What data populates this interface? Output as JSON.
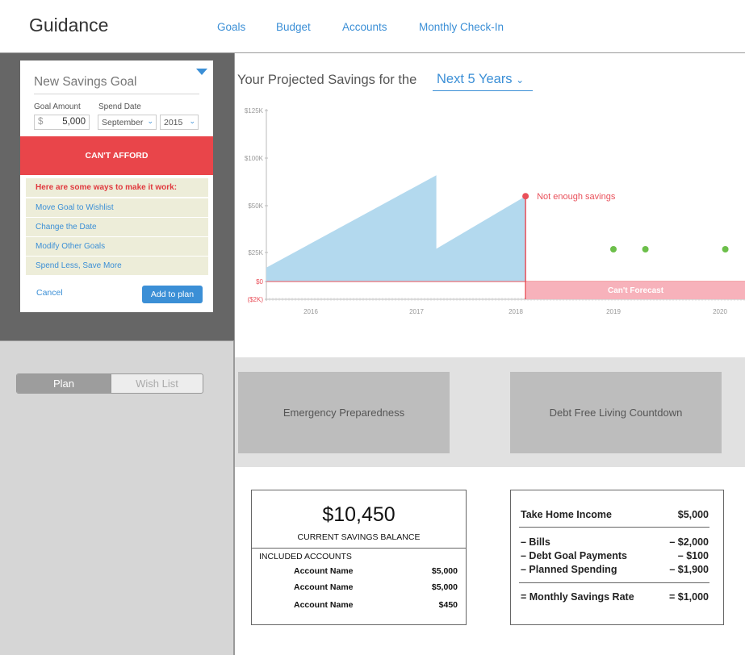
{
  "app": {
    "title": "Guidance"
  },
  "nav": {
    "goals": "Goals",
    "budget": "Budget",
    "accounts": "Accounts",
    "checkin": "Monthly Check-In"
  },
  "goal_form": {
    "name_placeholder": "New Savings Goal",
    "amount_label": "Goal Amount",
    "spend_date_label": "Spend Date",
    "currency": "$",
    "amount": "5,000",
    "month": "September",
    "year": "2015",
    "status": "CAN'T AFFORD",
    "ways_title": "Here are some ways to make it work:",
    "options": [
      "Move Goal to Wishlist",
      "Change the Date",
      "Modify Other Goals",
      "Spend Less, Save More"
    ],
    "cancel": "Cancel",
    "add": "Add to plan"
  },
  "toggle": {
    "plan": "Plan",
    "wishlist": "Wish List"
  },
  "projection": {
    "title": "Your Projected Savings for the",
    "period": "Next 5 Years"
  },
  "chart_data": {
    "type": "area",
    "title": "Your Projected Savings for the Next 5 Years",
    "y_ticks": [
      "$125K",
      "$100K",
      "$50K",
      "$25K",
      "$0",
      "($2K)"
    ],
    "x_ticks": [
      "2016",
      "2017",
      "2018",
      "2019",
      "2020"
    ],
    "series": [
      {
        "x": [
          2015.5,
          2017.2,
          2017.2,
          2018.1
        ],
        "values": [
          12000,
          82000,
          27000,
          60000
        ]
      }
    ],
    "warning_label": "Not enough savings",
    "forecast_label": "Can't Forecast",
    "milestones_x": [
      2019.0,
      2019.3,
      2020.05
    ],
    "colors": {
      "area": "#b3d9ee",
      "warning": "#e9505a",
      "forecast": "#f7b2bb",
      "milestone": "#6cbf4a"
    }
  },
  "cards": {
    "emergency": "Emergency Preparedness",
    "debt": "Debt Free Living Countdown"
  },
  "savings": {
    "balance": "$10,450",
    "balance_label": "CURRENT SAVINGS BALANCE",
    "included_label": "INCLUDED ACCOUNTS",
    "accounts": [
      {
        "name": "Account Name",
        "value": "$5,000"
      },
      {
        "name": "Account Name",
        "value": "$5,000"
      },
      {
        "name": "Account Name",
        "value": "$450"
      }
    ]
  },
  "income": {
    "take_home_label": "Take Home Income",
    "take_home_value": "$5,000",
    "bills_label": "– Bills",
    "bills_value": "– $2,000",
    "debt_label": "– Debt Goal Payments",
    "debt_value": "– $100",
    "planned_label": "– Planned Spending",
    "planned_value": "– $1,900",
    "rate_label": "= Monthly Savings Rate",
    "rate_value": "= $1,000"
  }
}
